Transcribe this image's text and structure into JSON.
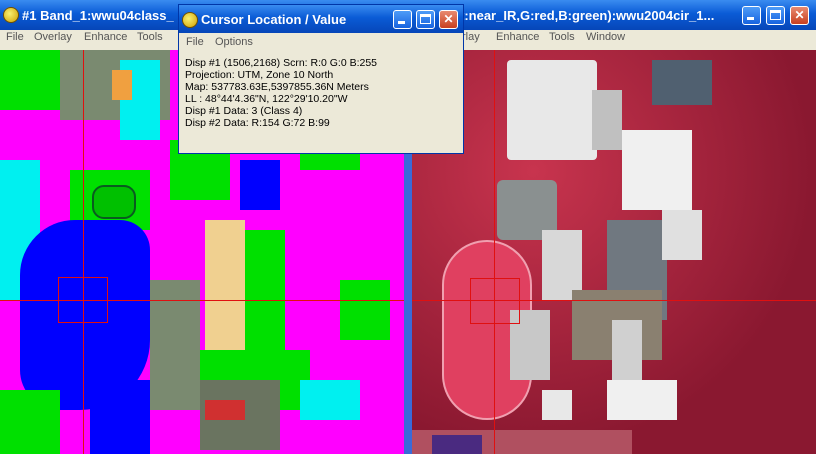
{
  "left_window": {
    "title": "#1 Band_1:wwu04class_",
    "menu": [
      "File",
      "Overlay",
      "Enhance",
      "Tools"
    ]
  },
  "right_window": {
    "title": "t:near_IR,G:red,B:green):wwu2004cir_1...",
    "menu": [
      "rlay",
      "Enhance",
      "Tools",
      "Window"
    ]
  },
  "dialog": {
    "title": "Cursor Location / Value",
    "menu": [
      "File",
      "Options"
    ],
    "lines": [
      "Disp #1 (1506,2168) Scrn: R:0 G:0 B:255",
      "Projection: UTM, Zone 10 North",
      "Map: 537783.63E,5397855.36N Meters",
      "LL : 48°44'4.36\"N, 122°29'10.20\"W",
      "Disp #1 Data: 3 (Class 4)",
      "Disp #2 Data: R:154 G:72 B:99"
    ]
  },
  "icons": {
    "app": "envi-globe-icon",
    "minimize": "minimize-icon",
    "maximize": "maximize-icon",
    "close": "close-icon"
  },
  "colors": {
    "titlebar": "#0a5bd6",
    "crosshair": "#e01010",
    "class_magenta": "#ff00ff",
    "class_green": "#00e000",
    "class_blue": "#0000ff",
    "class_cyan": "#00f0f0",
    "class_gray": "#7a8a70",
    "vegetation_red": "#c0304a"
  }
}
